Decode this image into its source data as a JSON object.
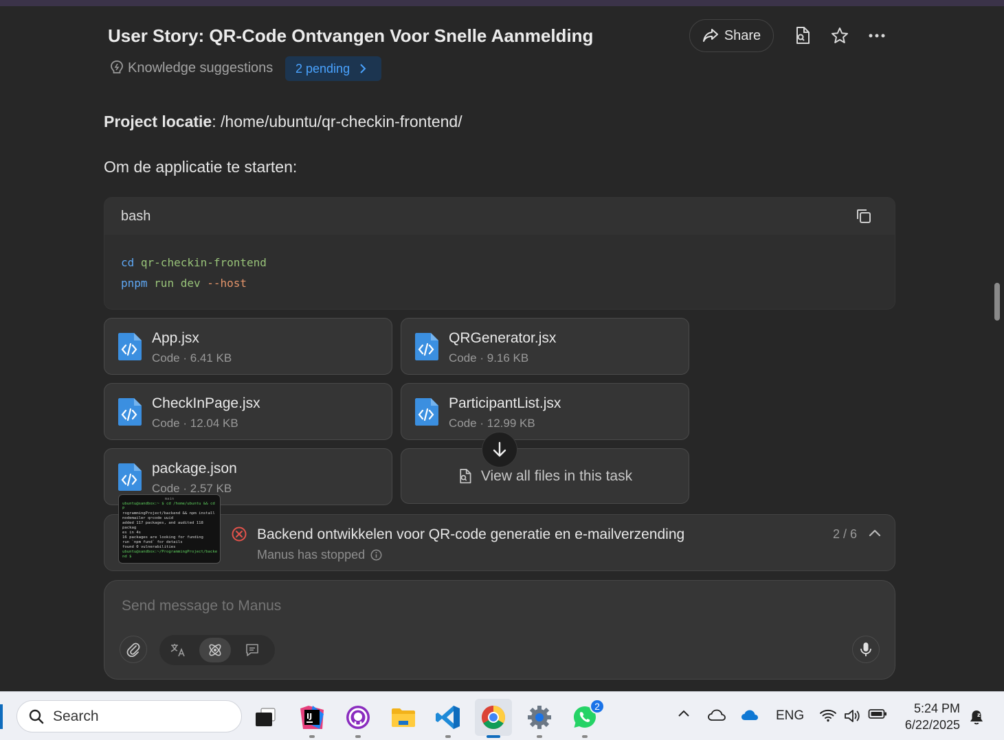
{
  "header": {
    "title": "User Story: QR-Code Ontvangen Voor Snelle Aanmelding",
    "share_label": "Share",
    "knowledge_label": "Knowledge suggestions",
    "pending_label": "2 pending"
  },
  "content": {
    "project_label": "Project locatie",
    "project_path": ": /home/ubuntu/qr-checkin-frontend/",
    "start_text": "Om de applicatie te starten:",
    "code": {
      "language": "bash",
      "lines": [
        {
          "cmd": "cd",
          "args": "qr-checkin-frontend",
          "flag": ""
        },
        {
          "cmd": "pnpm",
          "args": "run dev",
          "flag": "--host"
        }
      ]
    },
    "files": [
      {
        "name": "App.jsx",
        "meta": "Code · 6.41 KB"
      },
      {
        "name": "QRGenerator.jsx",
        "meta": "Code · 9.16 KB"
      },
      {
        "name": "CheckInPage.jsx",
        "meta": "Code · 12.04 KB"
      },
      {
        "name": "ParticipantList.jsx",
        "meta": "Code · 12.99 KB"
      },
      {
        "name": "package.json",
        "meta": "Code · 2.57 KB"
      }
    ],
    "view_all_label": "View all files in this task"
  },
  "task": {
    "title": "Backend ontwikkelen voor QR-code generatie en e-mailverzending",
    "status": "Manus has stopped",
    "progress": "2 / 6",
    "thumbnail_lines": [
      "main",
      "ubuntu@sandbox:~ $ cd /home/ubuntu && cd P",
      "rogrammingProject/backend && npm install",
      "nodemailer qrcode uuid",
      "added 117 packages, and audited 118 packag",
      "es in 4s",
      "16 packages are looking for funding",
      "  run `npm fund` for details",
      "found 0 vulnerabilities",
      "ubuntu@sandbox:~/ProgrammingProject/backe",
      "nd $"
    ]
  },
  "composer": {
    "placeholder": "Send message to Manus"
  },
  "taskbar": {
    "search_label": "Search",
    "whatsapp_badge": "2",
    "language": "ENG",
    "time": "5:24 PM",
    "date": "6/22/2025"
  },
  "colors": {
    "background": "#272727",
    "card": "#353535",
    "accent_blue": "#4aa3ff",
    "file_icon_blue": "#3b8fe0",
    "error_red": "#e5534b"
  }
}
